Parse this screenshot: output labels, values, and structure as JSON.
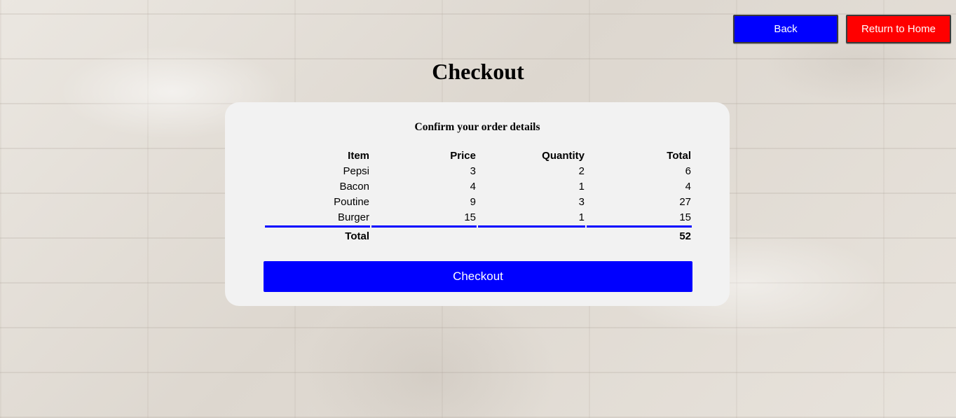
{
  "nav": {
    "back_label": "Back",
    "home_label": "Return to Home"
  },
  "page": {
    "title": "Checkout"
  },
  "order": {
    "subtitle": "Confirm your order details",
    "columns": [
      "Item",
      "Price",
      "Quantity",
      "Total"
    ],
    "rows": [
      {
        "item": "Pepsi",
        "price": "3",
        "quantity": "2",
        "total": "6"
      },
      {
        "item": "Bacon",
        "price": "4",
        "quantity": "1",
        "total": "4"
      },
      {
        "item": "Poutine",
        "price": "9",
        "quantity": "3",
        "total": "27"
      },
      {
        "item": "Burger",
        "price": "15",
        "quantity": "1",
        "total": "15"
      }
    ],
    "total_label": "Total",
    "grand_total": "52"
  },
  "actions": {
    "checkout_label": "Checkout"
  },
  "colors": {
    "primary_blue": "#0000ff",
    "danger_red": "#ff0000",
    "card_bg": "#f2f2f2"
  }
}
